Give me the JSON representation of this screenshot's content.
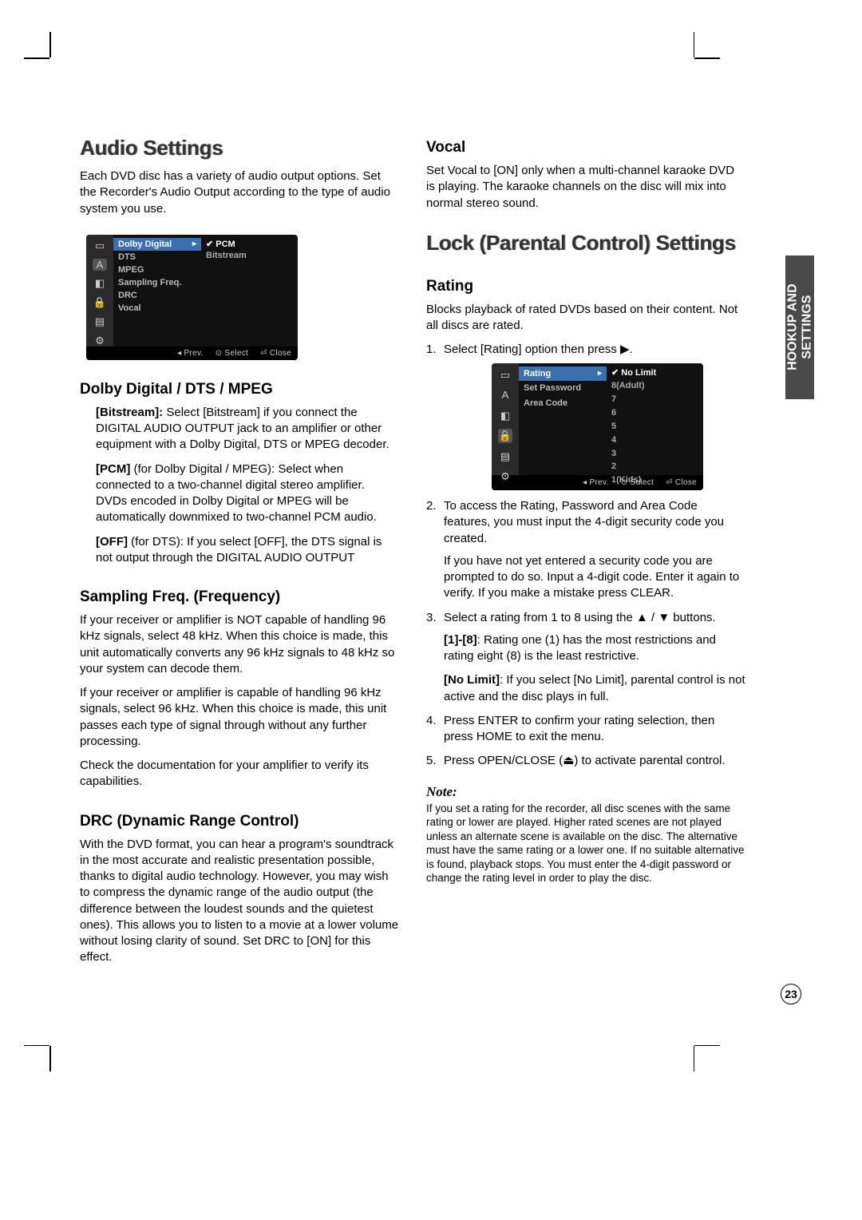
{
  "sideTab": {
    "line1": "HOOKUP AND",
    "line2": "SETTINGS"
  },
  "pageNumber": "23",
  "left": {
    "h1": "Audio Settings",
    "intro": "Each DVD disc has a variety of audio output options. Set the Recorder's Audio Output according to the type of audio system you use.",
    "osd": {
      "menu": [
        "Dolby Digital",
        "DTS",
        "MPEG",
        "Sampling Freq.",
        "DRC",
        "Vocal"
      ],
      "selectedIndex": 0,
      "options": [
        "PCM",
        "Bitstream"
      ],
      "optionActive": 0,
      "footer": {
        "prev": "◂ Prev.",
        "select": "⊙ Select",
        "close": "⏎ Close"
      }
    },
    "sec1": {
      "h2": "Dolby Digital / DTS / MPEG",
      "p1_b": "[Bitstream]:",
      "p1": " Select [Bitstream] if you connect the DIGITAL AUDIO OUTPUT jack to an amplifier or other equipment with a Dolby Digital, DTS or MPEG decoder.",
      "p2_b": "[PCM]",
      "p2": " (for Dolby Digital / MPEG): Select when connected to a two-channel digital stereo amplifier. DVDs encoded in Dolby Digital or MPEG will be automatically downmixed to two-channel PCM audio.",
      "p3_b": "[OFF]",
      "p3": " (for DTS): If you select [OFF], the DTS signal is not output through the DIGITAL AUDIO OUTPUT"
    },
    "sec2": {
      "h2": "Sampling Freq. (Frequency)",
      "p1": "If your receiver or amplifier is NOT capable of handling 96 kHz signals, select 48 kHz. When this choice is made, this unit automatically converts any 96 kHz signals to 48 kHz so your system can decode them.",
      "p2": "If your receiver or amplifier is capable of handling 96 kHz signals, select 96 kHz. When this choice is made, this unit passes each type of signal through without any further processing.",
      "p3": "Check the documentation for your amplifier to verify its capabilities."
    },
    "sec3": {
      "h2": "DRC (Dynamic Range Control)",
      "p1": "With the DVD format, you can hear a program's soundtrack in the most accurate and realistic presentation possible, thanks to digital audio technology. However, you may wish to compress the dynamic range of the audio output (the difference between the loudest sounds and the quietest ones). This allows you to listen to a movie at a lower volume without losing clarity of sound. Set DRC to [ON] for this effect."
    }
  },
  "right": {
    "vocal": {
      "h2": "Vocal",
      "p1": "Set Vocal to [ON] only when a multi-channel karaoke DVD is playing. The karaoke channels on the disc will mix into normal stereo sound."
    },
    "h1": "Lock (Parental Control) Settings",
    "rating": {
      "h2": "Rating",
      "intro": "Blocks playback of rated DVDs based on their content. Not all discs are rated.",
      "step1": "Select [Rating] option then press ▶.",
      "step2": "To access the Rating, Password and Area Code features, you must input the 4-digit security code you created.",
      "step2b": "If you have not yet entered a security code you are prompted to do so. Input a 4-digit code. Enter it again to verify. If you make a mistake press CLEAR.",
      "step3": "Select a rating from 1 to 8 using the ▲ / ▼ buttons.",
      "step3a_b": "[1]-[8]",
      "step3a": ": Rating one (1) has the most restrictions and rating eight (8) is the least restrictive.",
      "step3b_b": "[No Limit]",
      "step3b": ": If you select [No Limit], parental control is not active and the disc plays in full.",
      "step4": "Press ENTER to confirm your rating selection, then press HOME to exit the menu.",
      "step5": "Press OPEN/CLOSE (⏏) to activate parental control."
    },
    "osd": {
      "menu": [
        "Rating",
        "Set Password",
        "Area Code"
      ],
      "selectedIndex": 0,
      "options": [
        "No Limit",
        "8(Adult)",
        "7",
        "6",
        "5",
        "4",
        "3",
        "2",
        "1(Kids)"
      ],
      "optionActive": 0,
      "footer": {
        "prev": "◂ Prev.",
        "select": "⊙ Select",
        "close": "⏎ Close"
      }
    },
    "note": {
      "h": "Note:",
      "text": "If you set a rating for the recorder, all disc scenes with the same rating or lower are played. Higher rated scenes are not played unless an alternate scene is available on the disc. The alternative must have the same rating or a lower one. If no suitable alternative is found, playback stops. You must enter the 4-digit password or change the rating level in order to play the disc."
    }
  }
}
